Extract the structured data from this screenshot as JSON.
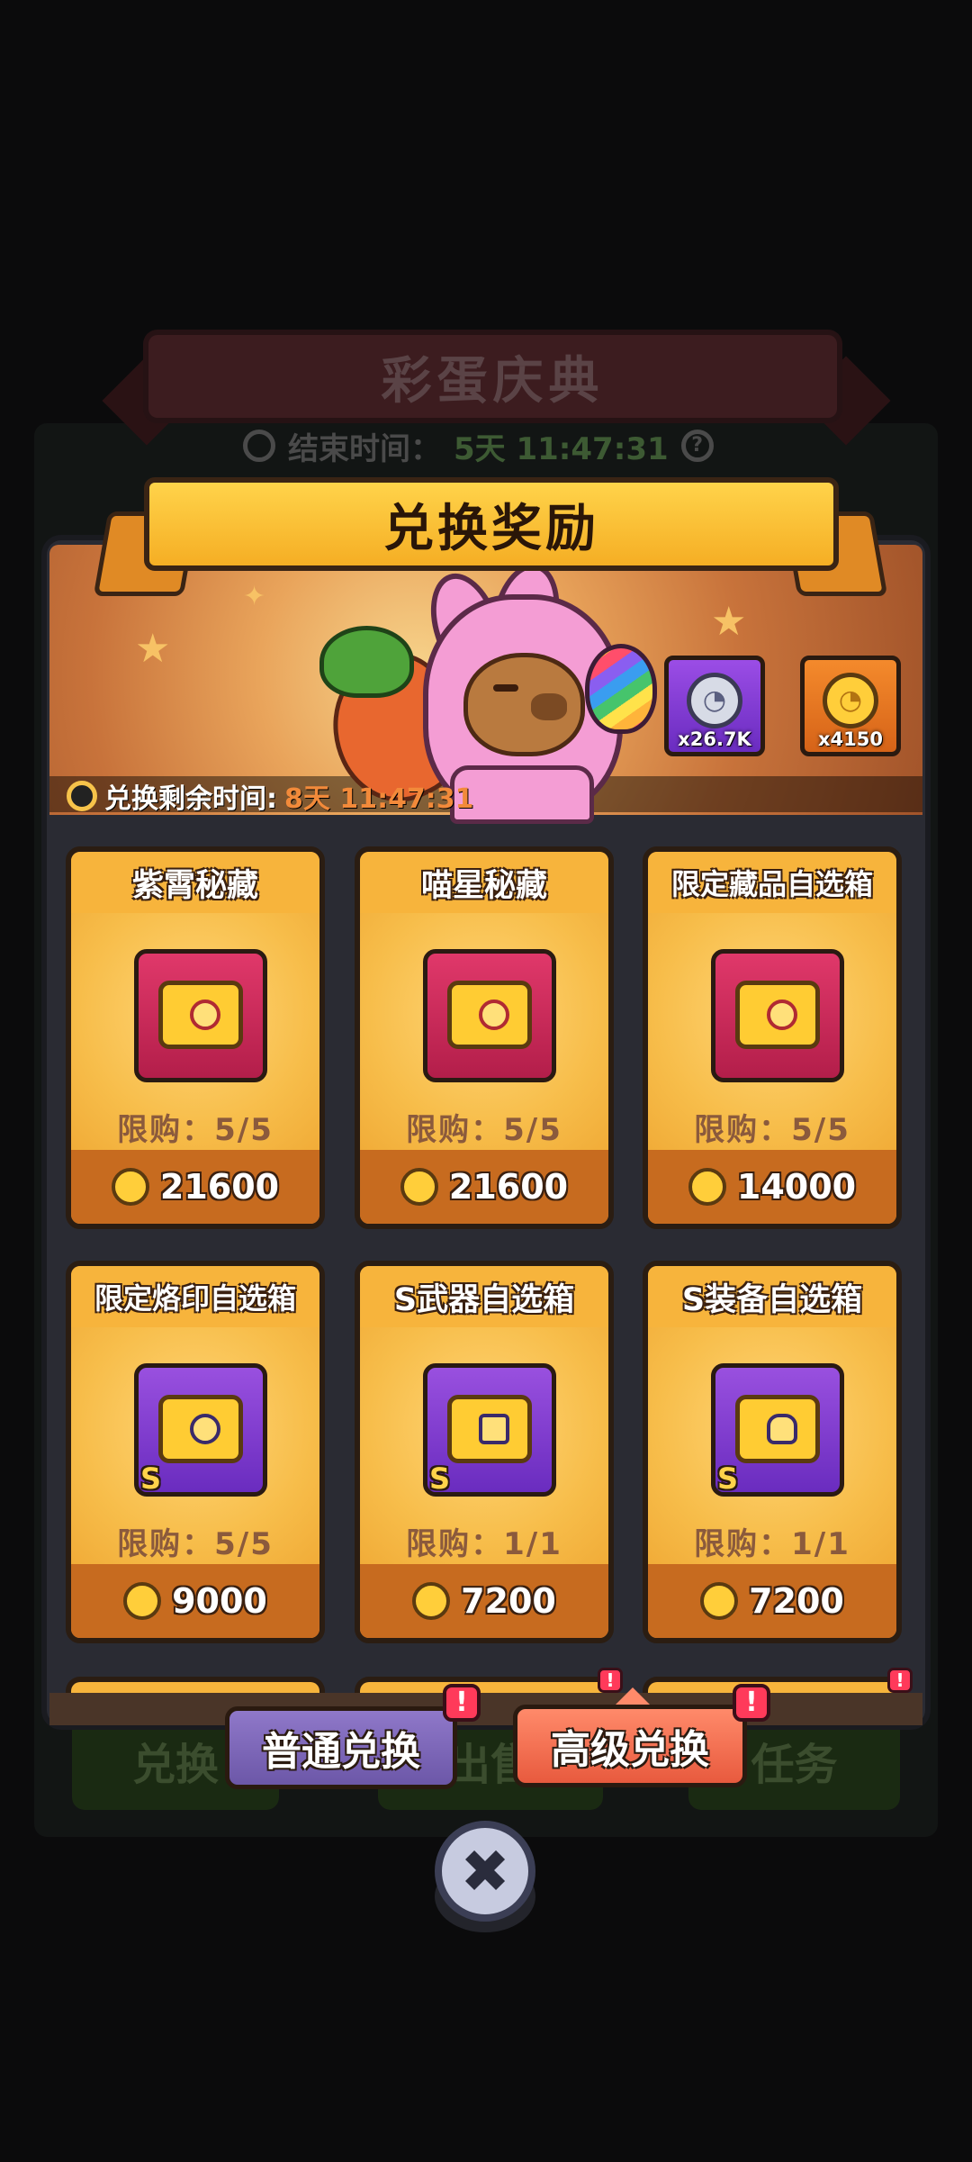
{
  "background": {
    "event_title": "彩蛋庆典",
    "timer_label": "结束时间：",
    "timer_value": "5天 11:47:31",
    "help_symbol": "?",
    "tabs": [
      "兑换",
      "出售",
      "任务"
    ]
  },
  "modal": {
    "title": "兑换奖励",
    "currencies": [
      {
        "icon": "silver-bunny-coin-icon",
        "count": "x26.7K",
        "coin_symbol": "◔"
      },
      {
        "icon": "gold-bunny-coin-icon",
        "count": "x4150",
        "coin_symbol": "◔"
      }
    ],
    "remaining_label": "兑换剩余时间:",
    "remaining_value": "8天 11:47:31",
    "items": [
      {
        "name": "紫霄秘藏",
        "limit": "限购：5/5",
        "price": "21600",
        "box_color": "red",
        "grade": ""
      },
      {
        "name": "喵星秘藏",
        "limit": "限购：5/5",
        "price": "21600",
        "box_color": "red",
        "grade": ""
      },
      {
        "name": "限定藏品自选箱",
        "limit": "限购：5/5",
        "price": "14000",
        "box_color": "red",
        "grade": ""
      },
      {
        "name": "限定烙印自选箱",
        "limit": "限购：5/5",
        "price": "9000",
        "box_color": "purple",
        "grade": "S"
      },
      {
        "name": "S武器自选箱",
        "limit": "限购：1/1",
        "price": "7200",
        "box_color": "purple",
        "grade": "S"
      },
      {
        "name": "S装备自选箱",
        "limit": "限购：1/1",
        "price": "7200",
        "box_color": "purple",
        "grade": "S"
      }
    ],
    "tabs": {
      "normal": "普通兑换",
      "advanced": "高级兑换",
      "alert_symbol": "!"
    },
    "close_symbol": "✖"
  },
  "colors": {
    "accent_gold": "#f7b43c",
    "price_bar": "#c76b1f",
    "countdown": "#f28a3a"
  }
}
